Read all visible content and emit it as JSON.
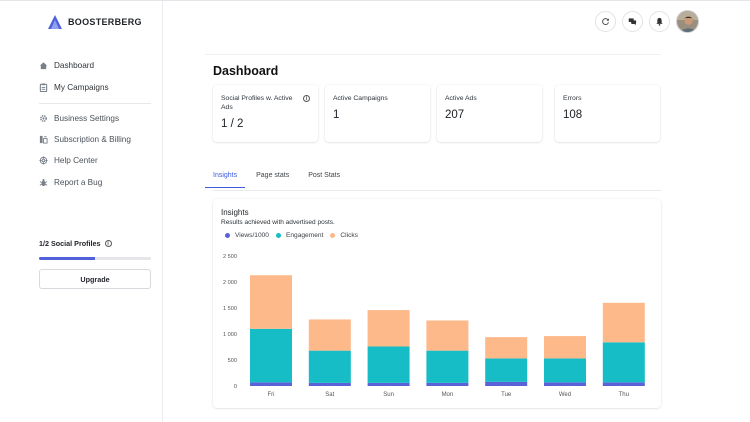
{
  "brand": {
    "name": "BOOSTERBERG",
    "logo_color": "#4f62db"
  },
  "sidebar": {
    "primary": [
      {
        "label": "Dashboard",
        "icon": "home-icon"
      },
      {
        "label": "My Campaigns",
        "icon": "clipboard-icon"
      }
    ],
    "secondary": [
      {
        "label": "Business Settings",
        "icon": "gear-icon"
      },
      {
        "label": "Subscription & Billing",
        "icon": "billing-icon"
      },
      {
        "label": "Help Center",
        "icon": "lifebuoy-icon"
      },
      {
        "label": "Report a Bug",
        "icon": "bug-icon"
      }
    ],
    "profiles_label": "1/2 Social Profiles",
    "profiles_progress": 0.5,
    "upgrade_label": "Upgrade"
  },
  "topbar": {
    "icons": [
      "refresh-icon",
      "chat-icon",
      "bell-icon"
    ],
    "avatar": "user-avatar"
  },
  "page": {
    "title": "Dashboard"
  },
  "stats": [
    {
      "label": "Social Profiles w. Active Ads",
      "value": "1 / 2",
      "info": true
    },
    {
      "label": "Active Campaigns",
      "value": "1",
      "info": false
    },
    {
      "label": "Active Ads",
      "value": "207",
      "info": false
    },
    {
      "label": "Errors",
      "value": "108",
      "info": false
    }
  ],
  "tabs": [
    "Insights",
    "Page stats",
    "Post Stats"
  ],
  "active_tab": "Insights",
  "insights": {
    "title": "Insights",
    "subtitle": "Results achieved with advertised posts."
  },
  "chart_data": {
    "type": "bar",
    "stacked": true,
    "categories": [
      "Fri",
      "Sat",
      "Sun",
      "Mon",
      "Tue",
      "Wed",
      "Thu"
    ],
    "series": [
      {
        "name": "Views/1000",
        "color": "#5b62d9",
        "values": [
          70,
          60,
          60,
          60,
          80,
          70,
          70
        ]
      },
      {
        "name": "Engagement",
        "color": "#16bcc6",
        "values": [
          1030,
          620,
          700,
          620,
          450,
          460,
          770
        ]
      },
      {
        "name": "Clicks",
        "color": "#fdb98a",
        "values": [
          1030,
          600,
          700,
          580,
          410,
          430,
          760
        ]
      }
    ],
    "ylim": [
      0,
      2500
    ],
    "yticks": [
      "0",
      "500",
      "1 000",
      "1 500",
      "2 000",
      "2 500"
    ],
    "ytick_values": [
      0,
      500,
      1000,
      1500,
      2000,
      2500
    ],
    "legend": "top-left",
    "grid": false
  }
}
